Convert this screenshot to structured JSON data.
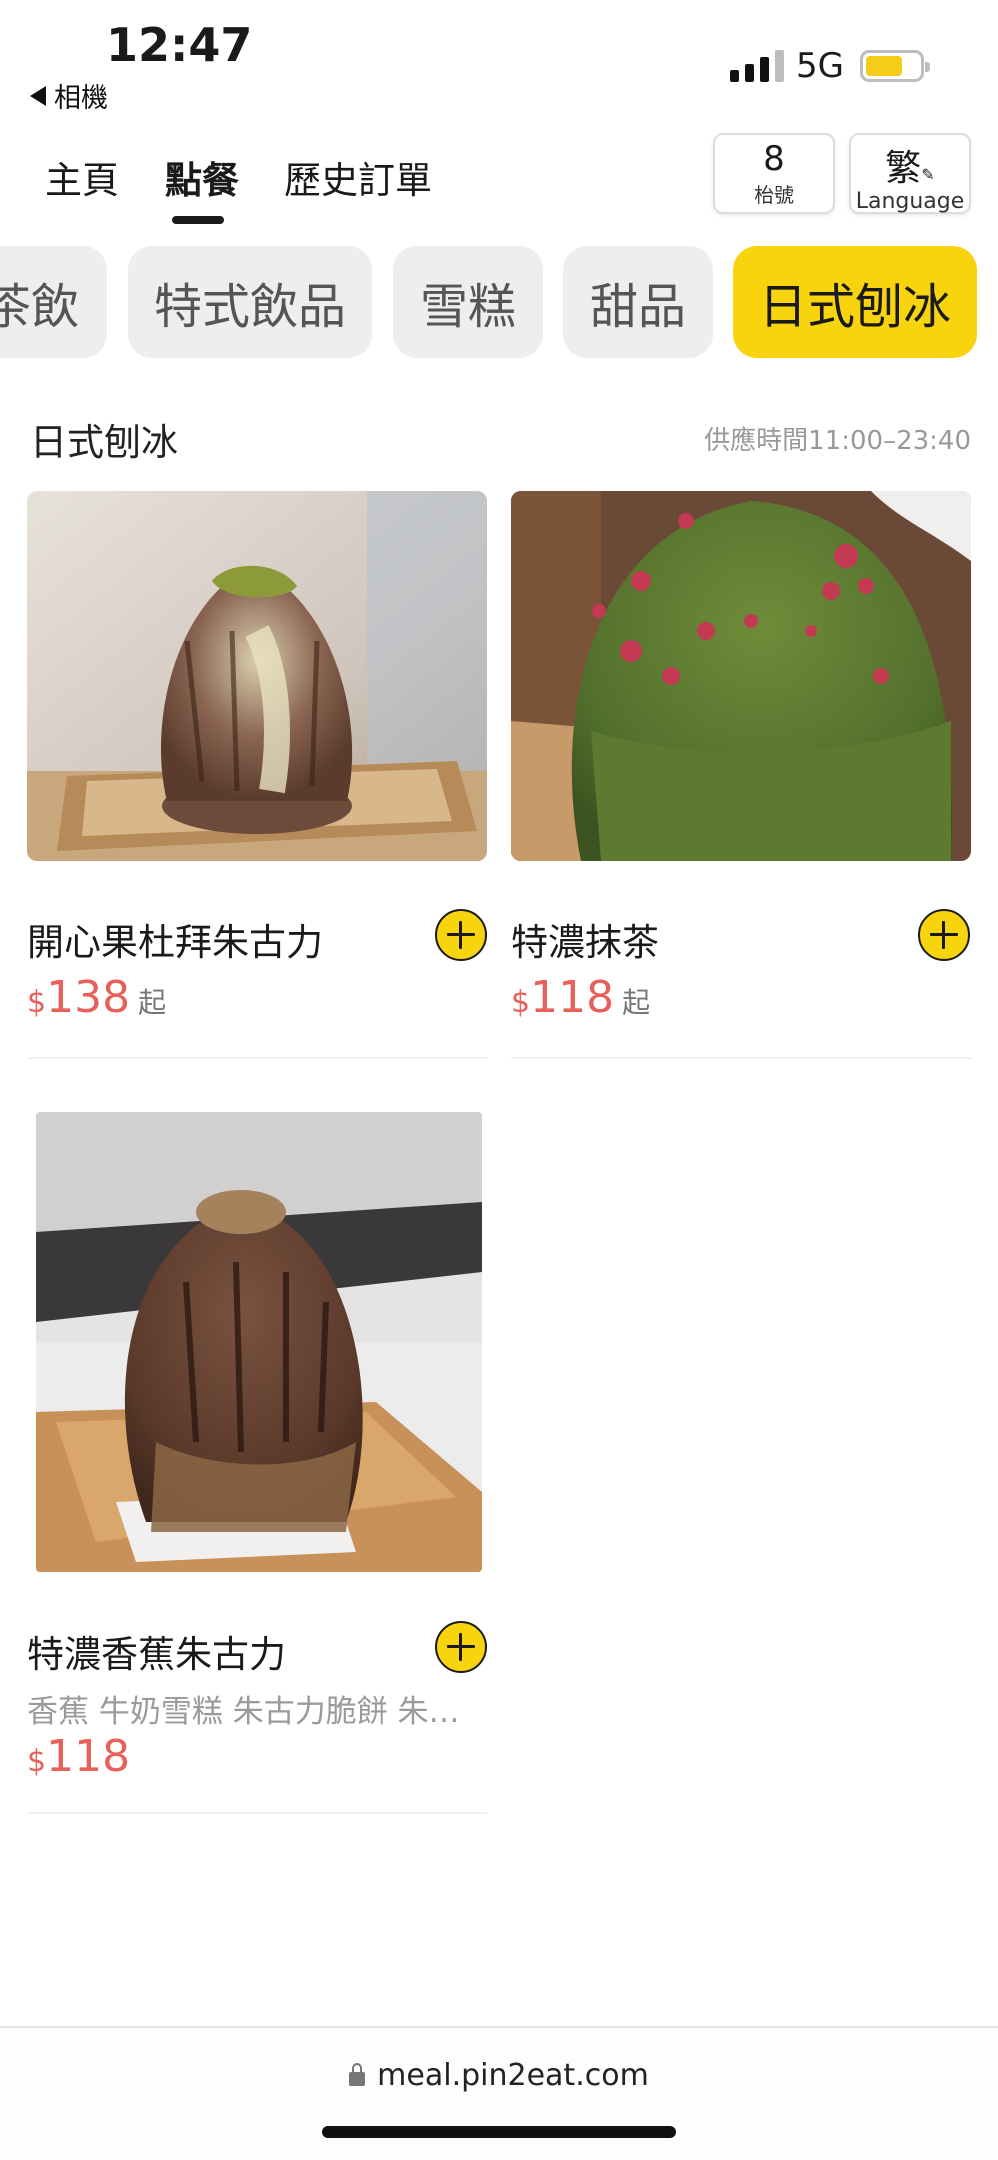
{
  "status_bar": {
    "time": "12:47",
    "back_app": "相機",
    "network": "5G"
  },
  "nav": {
    "tabs": [
      {
        "label": "主頁",
        "active": false
      },
      {
        "label": "點餐",
        "active": true
      },
      {
        "label": "歷史訂單",
        "active": false
      }
    ],
    "table_number": "8",
    "table_label": "枱號",
    "language_short": "繁",
    "language_label": "Language"
  },
  "categories": [
    {
      "label": "茶飲",
      "active": false
    },
    {
      "label": "特式飲品",
      "active": false
    },
    {
      "label": "雪糕",
      "active": false
    },
    {
      "label": "甜品",
      "active": false
    },
    {
      "label": "日式刨冰",
      "active": true
    }
  ],
  "section": {
    "title": "日式刨冰",
    "hours": "供應時間11:00–23:40"
  },
  "products": [
    {
      "name": "開心果杜拜朱古力",
      "currency": "$",
      "price": "138",
      "suffix": "起",
      "description": ""
    },
    {
      "name": "特濃抹茶",
      "currency": "$",
      "price": "118",
      "suffix": "起",
      "description": ""
    },
    {
      "name": "特濃香蕉朱古力",
      "currency": "$",
      "price": "118",
      "suffix": "",
      "description": "香蕉 牛奶雪糕 朱古力脆餅 朱古力醬"
    }
  ],
  "browser": {
    "url": "meal.pin2eat.com"
  },
  "colors": {
    "accent_yellow": "#f8d40f",
    "price_red": "#e8605a",
    "chip_gray": "#eeeeee"
  },
  "icons": [
    "back-triangle-icon",
    "signal-icon",
    "battery-icon",
    "pencil-icon",
    "plus-icon",
    "lock-icon"
  ]
}
